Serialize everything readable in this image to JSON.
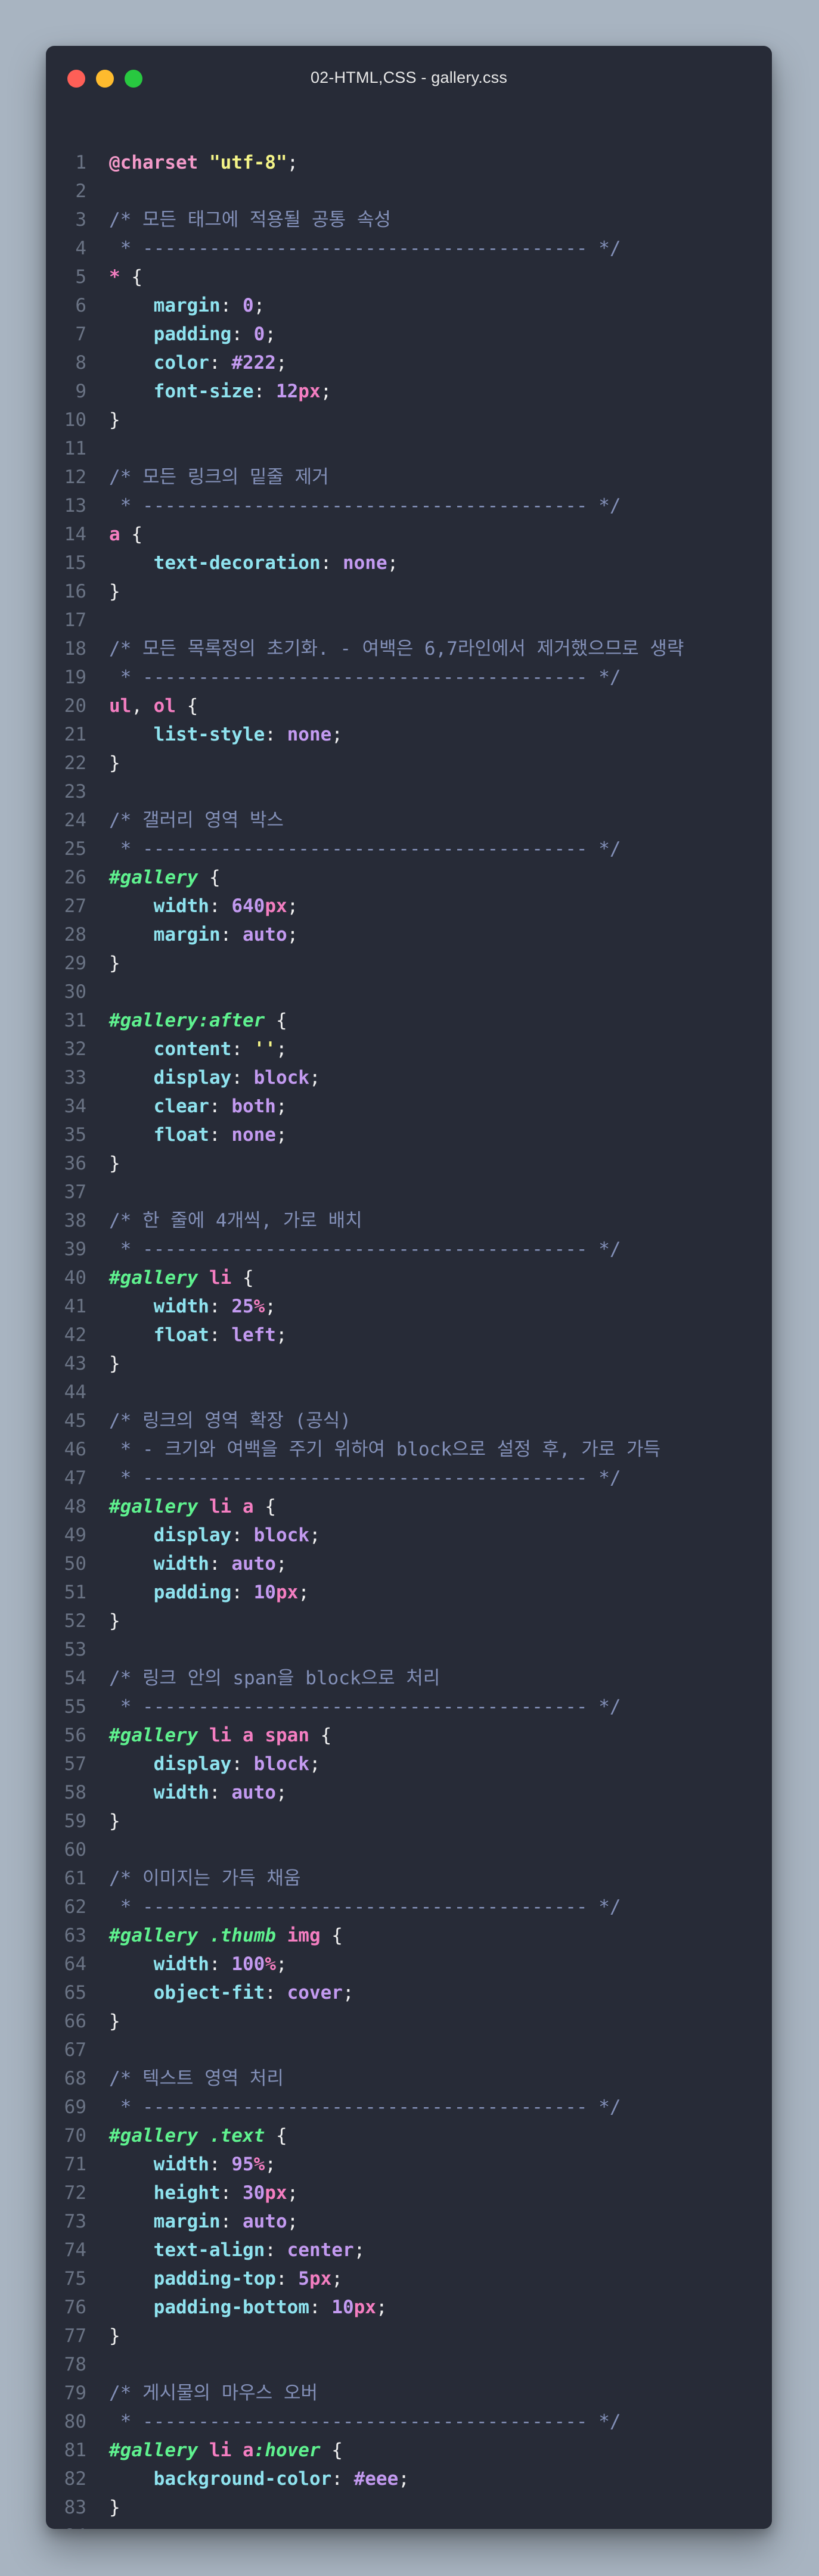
{
  "window": {
    "title": "02-HTML,CSS - gallery.css",
    "traffic_lights": {
      "close": "#fe5f57",
      "minimize": "#febb2e",
      "zoom": "#28c840"
    }
  },
  "editor": {
    "language": "css",
    "lines": [
      [
        {
          "t": "@charset ",
          "k": "at"
        },
        {
          "t": "\"utf-8\"",
          "k": "str"
        },
        {
          "t": ";",
          "k": "punc"
        }
      ],
      [],
      [
        {
          "t": "/* 모든 태그에 적용될 공통 속성",
          "k": "comment"
        }
      ],
      [
        {
          "t": " * ---------------------------------------- */",
          "k": "comment"
        }
      ],
      [
        {
          "t": "*",
          "k": "sel"
        },
        {
          "t": " {",
          "k": "punc"
        }
      ],
      [
        {
          "t": "    ",
          "k": "plain"
        },
        {
          "t": "margin",
          "k": "prop"
        },
        {
          "t": ": ",
          "k": "punc"
        },
        {
          "t": "0",
          "k": "num"
        },
        {
          "t": ";",
          "k": "punc"
        }
      ],
      [
        {
          "t": "    ",
          "k": "plain"
        },
        {
          "t": "padding",
          "k": "prop"
        },
        {
          "t": ": ",
          "k": "punc"
        },
        {
          "t": "0",
          "k": "num"
        },
        {
          "t": ";",
          "k": "punc"
        }
      ],
      [
        {
          "t": "    ",
          "k": "plain"
        },
        {
          "t": "color",
          "k": "prop"
        },
        {
          "t": ": ",
          "k": "punc"
        },
        {
          "t": "#222",
          "k": "num"
        },
        {
          "t": ";",
          "k": "punc"
        }
      ],
      [
        {
          "t": "    ",
          "k": "plain"
        },
        {
          "t": "font-size",
          "k": "prop"
        },
        {
          "t": ": ",
          "k": "punc"
        },
        {
          "t": "12",
          "k": "num"
        },
        {
          "t": "px",
          "k": "unit"
        },
        {
          "t": ";",
          "k": "punc"
        }
      ],
      [
        {
          "t": "}",
          "k": "punc"
        }
      ],
      [],
      [
        {
          "t": "/* 모든 링크의 밑줄 제거",
          "k": "comment"
        }
      ],
      [
        {
          "t": " * ---------------------------------------- */",
          "k": "comment"
        }
      ],
      [
        {
          "t": "a",
          "k": "sel"
        },
        {
          "t": " {",
          "k": "punc"
        }
      ],
      [
        {
          "t": "    ",
          "k": "plain"
        },
        {
          "t": "text-decoration",
          "k": "prop"
        },
        {
          "t": ": ",
          "k": "punc"
        },
        {
          "t": "none",
          "k": "kw"
        },
        {
          "t": ";",
          "k": "punc"
        }
      ],
      [
        {
          "t": "}",
          "k": "punc"
        }
      ],
      [],
      [
        {
          "t": "/* 모든 목록정의 초기화. - 여백은 6,7라인에서 제거했으므로 생략",
          "k": "comment"
        }
      ],
      [
        {
          "t": " * ---------------------------------------- */",
          "k": "comment"
        }
      ],
      [
        {
          "t": "ul",
          "k": "sel"
        },
        {
          "t": ", ",
          "k": "punc"
        },
        {
          "t": "ol",
          "k": "sel"
        },
        {
          "t": " {",
          "k": "punc"
        }
      ],
      [
        {
          "t": "    ",
          "k": "plain"
        },
        {
          "t": "list-style",
          "k": "prop"
        },
        {
          "t": ": ",
          "k": "punc"
        },
        {
          "t": "none",
          "k": "kw"
        },
        {
          "t": ";",
          "k": "punc"
        }
      ],
      [
        {
          "t": "}",
          "k": "punc"
        }
      ],
      [],
      [
        {
          "t": "/* 갤러리 영역 박스",
          "k": "comment"
        }
      ],
      [
        {
          "t": " * ---------------------------------------- */",
          "k": "comment"
        }
      ],
      [
        {
          "t": "#gallery",
          "k": "id"
        },
        {
          "t": " {",
          "k": "punc"
        }
      ],
      [
        {
          "t": "    ",
          "k": "plain"
        },
        {
          "t": "width",
          "k": "prop"
        },
        {
          "t": ": ",
          "k": "punc"
        },
        {
          "t": "640",
          "k": "num"
        },
        {
          "t": "px",
          "k": "unit"
        },
        {
          "t": ";",
          "k": "punc"
        }
      ],
      [
        {
          "t": "    ",
          "k": "plain"
        },
        {
          "t": "margin",
          "k": "prop"
        },
        {
          "t": ": ",
          "k": "punc"
        },
        {
          "t": "auto",
          "k": "kw"
        },
        {
          "t": ";",
          "k": "punc"
        }
      ],
      [
        {
          "t": "}",
          "k": "punc"
        }
      ],
      [],
      [
        {
          "t": "#gallery",
          "k": "id"
        },
        {
          "t": ":after",
          "k": "pseudo"
        },
        {
          "t": " {",
          "k": "punc"
        }
      ],
      [
        {
          "t": "    ",
          "k": "plain"
        },
        {
          "t": "content",
          "k": "prop"
        },
        {
          "t": ": ",
          "k": "punc"
        },
        {
          "t": "''",
          "k": "str"
        },
        {
          "t": ";",
          "k": "punc"
        }
      ],
      [
        {
          "t": "    ",
          "k": "plain"
        },
        {
          "t": "display",
          "k": "prop"
        },
        {
          "t": ": ",
          "k": "punc"
        },
        {
          "t": "block",
          "k": "kw"
        },
        {
          "t": ";",
          "k": "punc"
        }
      ],
      [
        {
          "t": "    ",
          "k": "plain"
        },
        {
          "t": "clear",
          "k": "prop"
        },
        {
          "t": ": ",
          "k": "punc"
        },
        {
          "t": "both",
          "k": "kw"
        },
        {
          "t": ";",
          "k": "punc"
        }
      ],
      [
        {
          "t": "    ",
          "k": "plain"
        },
        {
          "t": "float",
          "k": "prop"
        },
        {
          "t": ": ",
          "k": "punc"
        },
        {
          "t": "none",
          "k": "kw"
        },
        {
          "t": ";",
          "k": "punc"
        }
      ],
      [
        {
          "t": "}",
          "k": "punc"
        }
      ],
      [],
      [
        {
          "t": "/* 한 줄에 4개씩, 가로 배치",
          "k": "comment"
        }
      ],
      [
        {
          "t": " * ---------------------------------------- */",
          "k": "comment"
        }
      ],
      [
        {
          "t": "#gallery",
          "k": "id"
        },
        {
          "t": " ",
          "k": "plain"
        },
        {
          "t": "li",
          "k": "sel"
        },
        {
          "t": " {",
          "k": "punc"
        }
      ],
      [
        {
          "t": "    ",
          "k": "plain"
        },
        {
          "t": "width",
          "k": "prop"
        },
        {
          "t": ": ",
          "k": "punc"
        },
        {
          "t": "25",
          "k": "num"
        },
        {
          "t": "%",
          "k": "unit"
        },
        {
          "t": ";",
          "k": "punc"
        }
      ],
      [
        {
          "t": "    ",
          "k": "plain"
        },
        {
          "t": "float",
          "k": "prop"
        },
        {
          "t": ": ",
          "k": "punc"
        },
        {
          "t": "left",
          "k": "kw"
        },
        {
          "t": ";",
          "k": "punc"
        }
      ],
      [
        {
          "t": "}",
          "k": "punc"
        }
      ],
      [],
      [
        {
          "t": "/* 링크의 영역 확장 (공식)",
          "k": "comment"
        }
      ],
      [
        {
          "t": " * - 크기와 여백을 주기 위하여 block으로 설정 후, 가로 가득",
          "k": "comment"
        }
      ],
      [
        {
          "t": " * ---------------------------------------- */",
          "k": "comment"
        }
      ],
      [
        {
          "t": "#gallery",
          "k": "id"
        },
        {
          "t": " ",
          "k": "plain"
        },
        {
          "t": "li",
          "k": "sel"
        },
        {
          "t": " ",
          "k": "plain"
        },
        {
          "t": "a",
          "k": "sel"
        },
        {
          "t": " {",
          "k": "punc"
        }
      ],
      [
        {
          "t": "    ",
          "k": "plain"
        },
        {
          "t": "display",
          "k": "prop"
        },
        {
          "t": ": ",
          "k": "punc"
        },
        {
          "t": "block",
          "k": "kw"
        },
        {
          "t": ";",
          "k": "punc"
        }
      ],
      [
        {
          "t": "    ",
          "k": "plain"
        },
        {
          "t": "width",
          "k": "prop"
        },
        {
          "t": ": ",
          "k": "punc"
        },
        {
          "t": "auto",
          "k": "kw"
        },
        {
          "t": ";",
          "k": "punc"
        }
      ],
      [
        {
          "t": "    ",
          "k": "plain"
        },
        {
          "t": "padding",
          "k": "prop"
        },
        {
          "t": ": ",
          "k": "punc"
        },
        {
          "t": "10",
          "k": "num"
        },
        {
          "t": "px",
          "k": "unit"
        },
        {
          "t": ";",
          "k": "punc"
        }
      ],
      [
        {
          "t": "}",
          "k": "punc"
        }
      ],
      [],
      [
        {
          "t": "/* 링크 안의 span을 block으로 처리",
          "k": "comment"
        }
      ],
      [
        {
          "t": " * ---------------------------------------- */",
          "k": "comment"
        }
      ],
      [
        {
          "t": "#gallery",
          "k": "id"
        },
        {
          "t": " ",
          "k": "plain"
        },
        {
          "t": "li",
          "k": "sel"
        },
        {
          "t": " ",
          "k": "plain"
        },
        {
          "t": "a",
          "k": "sel"
        },
        {
          "t": " ",
          "k": "plain"
        },
        {
          "t": "span",
          "k": "sel"
        },
        {
          "t": " {",
          "k": "punc"
        }
      ],
      [
        {
          "t": "    ",
          "k": "plain"
        },
        {
          "t": "display",
          "k": "prop"
        },
        {
          "t": ": ",
          "k": "punc"
        },
        {
          "t": "block",
          "k": "kw"
        },
        {
          "t": ";",
          "k": "punc"
        }
      ],
      [
        {
          "t": "    ",
          "k": "plain"
        },
        {
          "t": "width",
          "k": "prop"
        },
        {
          "t": ": ",
          "k": "punc"
        },
        {
          "t": "auto",
          "k": "kw"
        },
        {
          "t": ";",
          "k": "punc"
        }
      ],
      [
        {
          "t": "}",
          "k": "punc"
        }
      ],
      [],
      [
        {
          "t": "/* 이미지는 가득 채움",
          "k": "comment"
        }
      ],
      [
        {
          "t": " * ---------------------------------------- */",
          "k": "comment"
        }
      ],
      [
        {
          "t": "#gallery",
          "k": "id"
        },
        {
          "t": " ",
          "k": "plain"
        },
        {
          "t": ".thumb",
          "k": "cls"
        },
        {
          "t": " ",
          "k": "plain"
        },
        {
          "t": "img",
          "k": "sel"
        },
        {
          "t": " {",
          "k": "punc"
        }
      ],
      [
        {
          "t": "    ",
          "k": "plain"
        },
        {
          "t": "width",
          "k": "prop"
        },
        {
          "t": ": ",
          "k": "punc"
        },
        {
          "t": "100",
          "k": "num"
        },
        {
          "t": "%",
          "k": "unit"
        },
        {
          "t": ";",
          "k": "punc"
        }
      ],
      [
        {
          "t": "    ",
          "k": "plain"
        },
        {
          "t": "object-fit",
          "k": "prop"
        },
        {
          "t": ": ",
          "k": "punc"
        },
        {
          "t": "cover",
          "k": "kw"
        },
        {
          "t": ";",
          "k": "punc"
        }
      ],
      [
        {
          "t": "}",
          "k": "punc"
        }
      ],
      [],
      [
        {
          "t": "/* 텍스트 영역 처리",
          "k": "comment"
        }
      ],
      [
        {
          "t": " * ---------------------------------------- */",
          "k": "comment"
        }
      ],
      [
        {
          "t": "#gallery",
          "k": "id"
        },
        {
          "t": " ",
          "k": "plain"
        },
        {
          "t": ".text",
          "k": "cls"
        },
        {
          "t": " {",
          "k": "punc"
        }
      ],
      [
        {
          "t": "    ",
          "k": "plain"
        },
        {
          "t": "width",
          "k": "prop"
        },
        {
          "t": ": ",
          "k": "punc"
        },
        {
          "t": "95",
          "k": "num"
        },
        {
          "t": "%",
          "k": "unit"
        },
        {
          "t": ";",
          "k": "punc"
        }
      ],
      [
        {
          "t": "    ",
          "k": "plain"
        },
        {
          "t": "height",
          "k": "prop"
        },
        {
          "t": ": ",
          "k": "punc"
        },
        {
          "t": "30",
          "k": "num"
        },
        {
          "t": "px",
          "k": "unit"
        },
        {
          "t": ";",
          "k": "punc"
        }
      ],
      [
        {
          "t": "    ",
          "k": "plain"
        },
        {
          "t": "margin",
          "k": "prop"
        },
        {
          "t": ": ",
          "k": "punc"
        },
        {
          "t": "auto",
          "k": "kw"
        },
        {
          "t": ";",
          "k": "punc"
        }
      ],
      [
        {
          "t": "    ",
          "k": "plain"
        },
        {
          "t": "text-align",
          "k": "prop"
        },
        {
          "t": ": ",
          "k": "punc"
        },
        {
          "t": "center",
          "k": "kw"
        },
        {
          "t": ";",
          "k": "punc"
        }
      ],
      [
        {
          "t": "    ",
          "k": "plain"
        },
        {
          "t": "padding-top",
          "k": "prop"
        },
        {
          "t": ": ",
          "k": "punc"
        },
        {
          "t": "5",
          "k": "num"
        },
        {
          "t": "px",
          "k": "unit"
        },
        {
          "t": ";",
          "k": "punc"
        }
      ],
      [
        {
          "t": "    ",
          "k": "plain"
        },
        {
          "t": "padding-bottom",
          "k": "prop"
        },
        {
          "t": ": ",
          "k": "punc"
        },
        {
          "t": "10",
          "k": "num"
        },
        {
          "t": "px",
          "k": "unit"
        },
        {
          "t": ";",
          "k": "punc"
        }
      ],
      [
        {
          "t": "}",
          "k": "punc"
        }
      ],
      [],
      [
        {
          "t": "/* 게시물의 마우스 오버",
          "k": "comment"
        }
      ],
      [
        {
          "t": " * ---------------------------------------- */",
          "k": "comment"
        }
      ],
      [
        {
          "t": "#gallery",
          "k": "id"
        },
        {
          "t": " ",
          "k": "plain"
        },
        {
          "t": "li",
          "k": "sel"
        },
        {
          "t": " ",
          "k": "plain"
        },
        {
          "t": "a",
          "k": "sel"
        },
        {
          "t": ":hover",
          "k": "pseudo"
        },
        {
          "t": " {",
          "k": "punc"
        }
      ],
      [
        {
          "t": "    ",
          "k": "plain"
        },
        {
          "t": "background-color",
          "k": "prop"
        },
        {
          "t": ": ",
          "k": "punc"
        },
        {
          "t": "#eee",
          "k": "num"
        },
        {
          "t": ";",
          "k": "punc"
        }
      ],
      [
        {
          "t": "}",
          "k": "punc"
        }
      ],
      []
    ]
  }
}
